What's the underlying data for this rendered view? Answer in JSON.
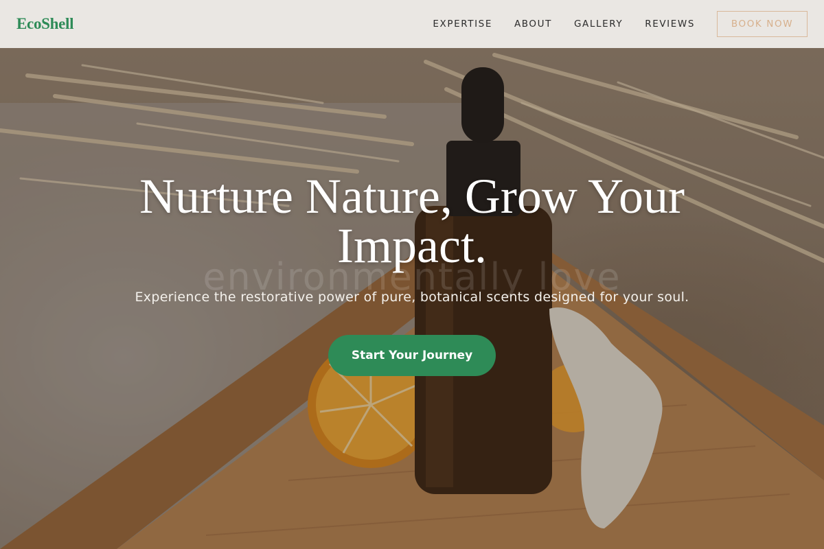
{
  "brand": {
    "name": "EcoShell"
  },
  "nav": {
    "links": [
      "EXPERTISE",
      "ABOUT",
      "GALLERY",
      "REVIEWS"
    ],
    "cta": "BOOK NOW"
  },
  "hero": {
    "title": "Nurture Nature, Grow Your Impact.",
    "watermark": "environmentally love",
    "subtitle": "Experience the restorative power of pure, botanical scents designed for your soul.",
    "cta": "Start Your Journey"
  },
  "colors": {
    "brand_green": "#2e8b57",
    "nav_background": "#eeece9",
    "book_button_accent": "#d7b08c"
  }
}
